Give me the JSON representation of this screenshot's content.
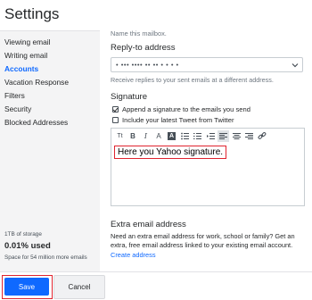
{
  "header": {
    "title": "Settings"
  },
  "sidebar": {
    "items": [
      {
        "label": "Viewing email"
      },
      {
        "label": "Writing email"
      },
      {
        "label": "Accounts"
      },
      {
        "label": "Vacation Response"
      },
      {
        "label": "Filters"
      },
      {
        "label": "Security"
      },
      {
        "label": "Blocked Addresses"
      }
    ],
    "active_index": 2,
    "storage": {
      "capacity": "1TB of storage",
      "used": "0.01% used",
      "space": "Space for 54 million more emails"
    }
  },
  "main": {
    "name_hint": "Name this mailbox.",
    "reply_to": {
      "label": "Reply-to address",
      "value": "• ••• •••• •• •• • • • •",
      "hint": "Receive replies to your sent emails at a different address."
    },
    "signature": {
      "label": "Signature",
      "append_label": "Append a signature to the emails you send",
      "append_checked": true,
      "tweet_label": "Include your latest Tweet from Twitter",
      "tweet_checked": false,
      "toolbar": [
        "Tt",
        "B",
        "I",
        "A",
        "A",
        "≡",
        "≡",
        "≡",
        "≡",
        "≡",
        "link"
      ],
      "text": "Here you Yahoo signature."
    },
    "extra": {
      "title": "Extra email address",
      "description": "Need an extra email address for work, school or family? Get an extra, free email address linked to your existing email account.",
      "link": "Create address"
    }
  },
  "footer": {
    "save_label": "Save",
    "cancel_label": "Cancel"
  },
  "colors": {
    "accent": "#0f69ff",
    "highlight": "#e0242f",
    "sidebar_bg": "#f4f4f5"
  }
}
